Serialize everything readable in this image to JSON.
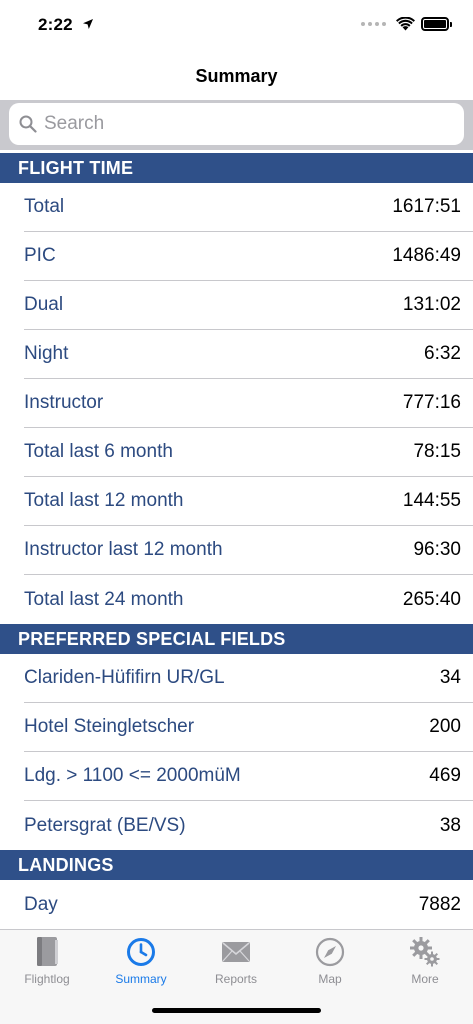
{
  "status": {
    "time": "2:22"
  },
  "nav": {
    "title": "Summary"
  },
  "search": {
    "placeholder": "Search",
    "value": ""
  },
  "sections": [
    {
      "header": "FLIGHT TIME",
      "rows": [
        {
          "label": "Total",
          "value": "1617:51"
        },
        {
          "label": "PIC",
          "value": "1486:49"
        },
        {
          "label": "Dual",
          "value": "131:02"
        },
        {
          "label": "Night",
          "value": "6:32"
        },
        {
          "label": "Instructor",
          "value": "777:16"
        },
        {
          "label": "Total last 6 month",
          "value": "78:15"
        },
        {
          "label": "Total last 12 month",
          "value": "144:55"
        },
        {
          "label": "Instructor last 12 month",
          "value": "96:30"
        },
        {
          "label": "Total last 24 month",
          "value": "265:40"
        }
      ]
    },
    {
      "header": "PREFERRED SPECIAL FIELDS",
      "rows": [
        {
          "label": "Clariden-Hüfifirn UR/GL",
          "value": "34"
        },
        {
          "label": "Hotel Steingletscher",
          "value": "200"
        },
        {
          "label": "Ldg. > 1100 <= 2000müM",
          "value": "469"
        },
        {
          "label": "Petersgrat (BE/VS)",
          "value": "38"
        }
      ]
    },
    {
      "header": "LANDINGS",
      "rows": [
        {
          "label": "Day",
          "value": "7882"
        }
      ]
    }
  ],
  "tabs": [
    {
      "label": "Flightlog",
      "icon": "book-icon",
      "active": false
    },
    {
      "label": "Summary",
      "icon": "clock-icon",
      "active": true
    },
    {
      "label": "Reports",
      "icon": "envelope-icon",
      "active": false
    },
    {
      "label": "Map",
      "icon": "compass-icon",
      "active": false
    },
    {
      "label": "More",
      "icon": "gears-icon",
      "active": false
    }
  ],
  "colors": {
    "section_header_bg": "#2f5089",
    "row_label": "#2c4a80",
    "tab_active": "#1a7ae8",
    "tab_inactive": "#8e8e93"
  }
}
